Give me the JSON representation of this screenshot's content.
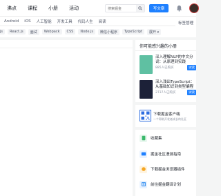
{
  "topnav": {
    "items": [
      "沸点",
      "课程",
      "小册",
      "活动"
    ]
  },
  "search": {
    "placeholder": "搜索掘金"
  },
  "write_button": {
    "label": "写文章"
  },
  "signin": {
    "label": "标签管理"
  },
  "categories": [
    "Android",
    "iOS",
    "人工智能",
    "开发工具",
    "代码人生",
    "阅读"
  ],
  "tags": [
    "js",
    "React.js",
    "面试",
    "Webpack",
    "CSS",
    "Node.js",
    "微信小程序",
    "TypeScript"
  ],
  "tags_more": "展开 ▾",
  "books": {
    "title": "你可能感兴趣的小册",
    "items": [
      {
        "title": "深入理解NLP的中文分词：从原理到实践",
        "meta": "885人已购买",
        "action": "试读"
      },
      {
        "title": "深入浅出TypeScript：从基础知识到类型编程",
        "meta": "2737人已购买",
        "action": "试读"
      }
    ]
  },
  "client": {
    "title": "下载掘金客户端",
    "subtitle": "一个帮助开发者成长的社区"
  },
  "links": [
    {
      "label": "收藏集",
      "icon": "collection-icon",
      "color": "#3ab86b"
    },
    {
      "label": "掘金社区漫游指南",
      "icon": "guide-icon",
      "color": "#1e80ff"
    },
    {
      "label": "下载掘金浏览器插件",
      "icon": "plugin-icon",
      "color": "#f5a623"
    },
    {
      "label": "前往掘金翻译计划",
      "icon": "translate-icon",
      "color": "#2d8cf0"
    }
  ]
}
